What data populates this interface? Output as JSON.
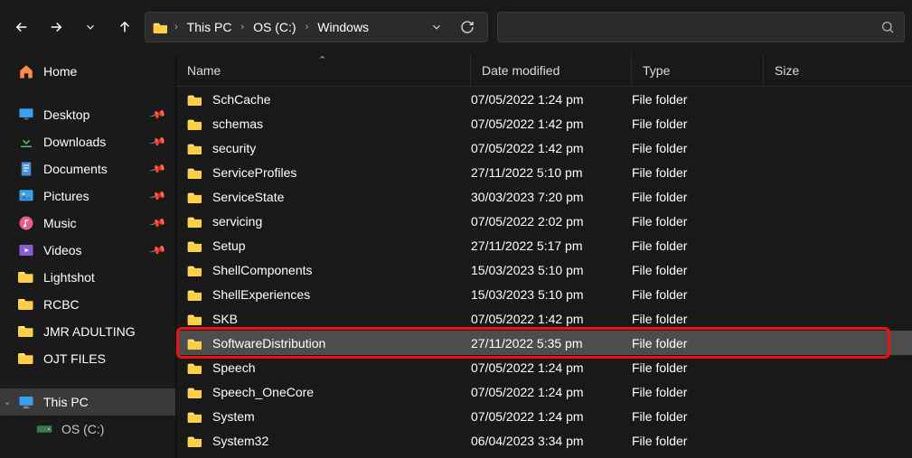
{
  "toolbar": {
    "breadcrumb": [
      "This PC",
      "OS (C:)",
      "Windows"
    ]
  },
  "sidebar": {
    "home": "Home",
    "quick": [
      {
        "icon": "desktop",
        "label": "Desktop",
        "pinned": true
      },
      {
        "icon": "download",
        "label": "Downloads",
        "pinned": true
      },
      {
        "icon": "document",
        "label": "Documents",
        "pinned": true
      },
      {
        "icon": "picture",
        "label": "Pictures",
        "pinned": true
      },
      {
        "icon": "music",
        "label": "Music",
        "pinned": true
      },
      {
        "icon": "video",
        "label": "Videos",
        "pinned": true
      },
      {
        "icon": "folder",
        "label": "Lightshot",
        "pinned": false
      },
      {
        "icon": "folder",
        "label": "RCBC",
        "pinned": false
      },
      {
        "icon": "folder",
        "label": "JMR ADULTING",
        "pinned": false
      },
      {
        "icon": "folder",
        "label": "OJT FILES",
        "pinned": false
      }
    ],
    "thispc": {
      "label": "This PC",
      "expanded": true
    },
    "drive": {
      "label": "OS (C:)"
    }
  },
  "columns": {
    "name": "Name",
    "date": "Date modified",
    "type": "Type",
    "size": "Size"
  },
  "rows": [
    {
      "name": "SchCache",
      "date": "07/05/2022 1:24 pm",
      "type": "File folder"
    },
    {
      "name": "schemas",
      "date": "07/05/2022 1:42 pm",
      "type": "File folder"
    },
    {
      "name": "security",
      "date": "07/05/2022 1:42 pm",
      "type": "File folder"
    },
    {
      "name": "ServiceProfiles",
      "date": "27/11/2022 5:10 pm",
      "type": "File folder"
    },
    {
      "name": "ServiceState",
      "date": "30/03/2023 7:20 pm",
      "type": "File folder"
    },
    {
      "name": "servicing",
      "date": "07/05/2022 2:02 pm",
      "type": "File folder"
    },
    {
      "name": "Setup",
      "date": "27/11/2022 5:17 pm",
      "type": "File folder"
    },
    {
      "name": "ShellComponents",
      "date": "15/03/2023 5:10 pm",
      "type": "File folder"
    },
    {
      "name": "ShellExperiences",
      "date": "15/03/2023 5:10 pm",
      "type": "File folder"
    },
    {
      "name": "SKB",
      "date": "07/05/2022 1:42 pm",
      "type": "File folder"
    },
    {
      "name": "SoftwareDistribution",
      "date": "27/11/2022 5:35 pm",
      "type": "File folder",
      "selected": true
    },
    {
      "name": "Speech",
      "date": "07/05/2022 1:24 pm",
      "type": "File folder"
    },
    {
      "name": "Speech_OneCore",
      "date": "07/05/2022 1:24 pm",
      "type": "File folder"
    },
    {
      "name": "System",
      "date": "07/05/2022 1:24 pm",
      "type": "File folder"
    },
    {
      "name": "System32",
      "date": "06/04/2023 3:34 pm",
      "type": "File folder"
    }
  ],
  "highlight_row_index": 10
}
